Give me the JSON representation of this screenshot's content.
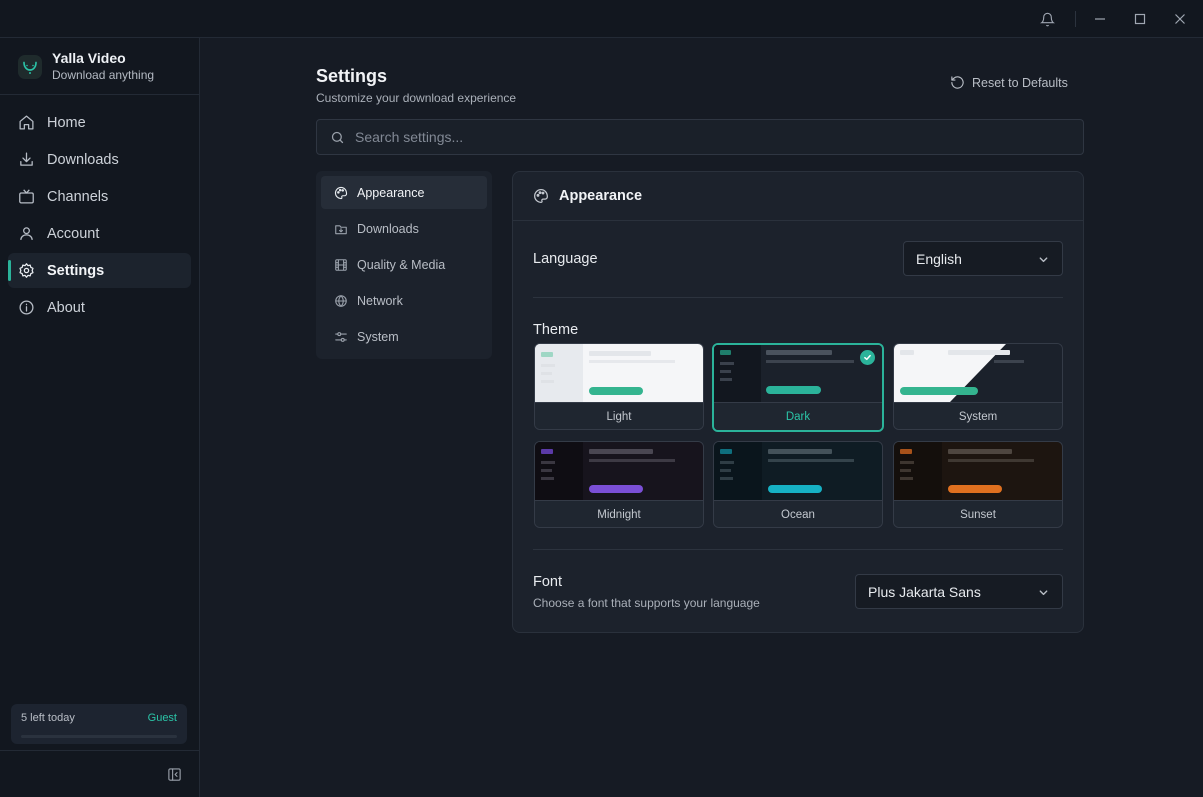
{
  "app": {
    "name": "Yalla Video",
    "tagline": "Download anything"
  },
  "window": {
    "icons": [
      "bell-icon",
      "minimize-icon",
      "maximize-icon",
      "close-icon"
    ]
  },
  "sidebar": {
    "items": [
      {
        "label": "Home",
        "icon": "home-icon"
      },
      {
        "label": "Downloads",
        "icon": "download-icon"
      },
      {
        "label": "Channels",
        "icon": "tv-icon"
      },
      {
        "label": "Account",
        "icon": "user-icon"
      },
      {
        "label": "Settings",
        "icon": "gear-icon",
        "active": true
      },
      {
        "label": "About",
        "icon": "info-icon"
      }
    ],
    "quota": {
      "text": "5 left today",
      "badge": "Guest",
      "fill_fraction": 0.0
    }
  },
  "page": {
    "title": "Settings",
    "subtitle": "Customize your download experience",
    "reset_label": "Reset to Defaults",
    "search_placeholder": "Search settings..."
  },
  "categories": [
    {
      "label": "Appearance",
      "icon": "palette-icon",
      "active": true
    },
    {
      "label": "Downloads",
      "icon": "folder-download-icon"
    },
    {
      "label": "Quality & Media",
      "icon": "film-icon"
    },
    {
      "label": "Network",
      "icon": "globe-icon"
    },
    {
      "label": "System",
      "icon": "sliders-icon"
    }
  ],
  "appearance": {
    "title": "Appearance",
    "language": {
      "label": "Language",
      "value": "English"
    },
    "theme": {
      "label": "Theme",
      "selected": "Dark",
      "options": [
        {
          "label": "Light",
          "accent": "#34b48f"
        },
        {
          "label": "Dark",
          "accent": "#2bb39a"
        },
        {
          "label": "System",
          "accent": "#34b48f"
        },
        {
          "label": "Midnight",
          "accent": "#7b4fd6"
        },
        {
          "label": "Ocean",
          "accent": "#16b1c4"
        },
        {
          "label": "Sunset",
          "accent": "#e0701f"
        }
      ]
    },
    "font": {
      "label": "Font",
      "description": "Choose a font that supports your language",
      "value": "Plus Jakarta Sans"
    }
  },
  "colors": {
    "accent": "#2bb39a",
    "background": "#161b24",
    "sidebar": "#12171f"
  }
}
